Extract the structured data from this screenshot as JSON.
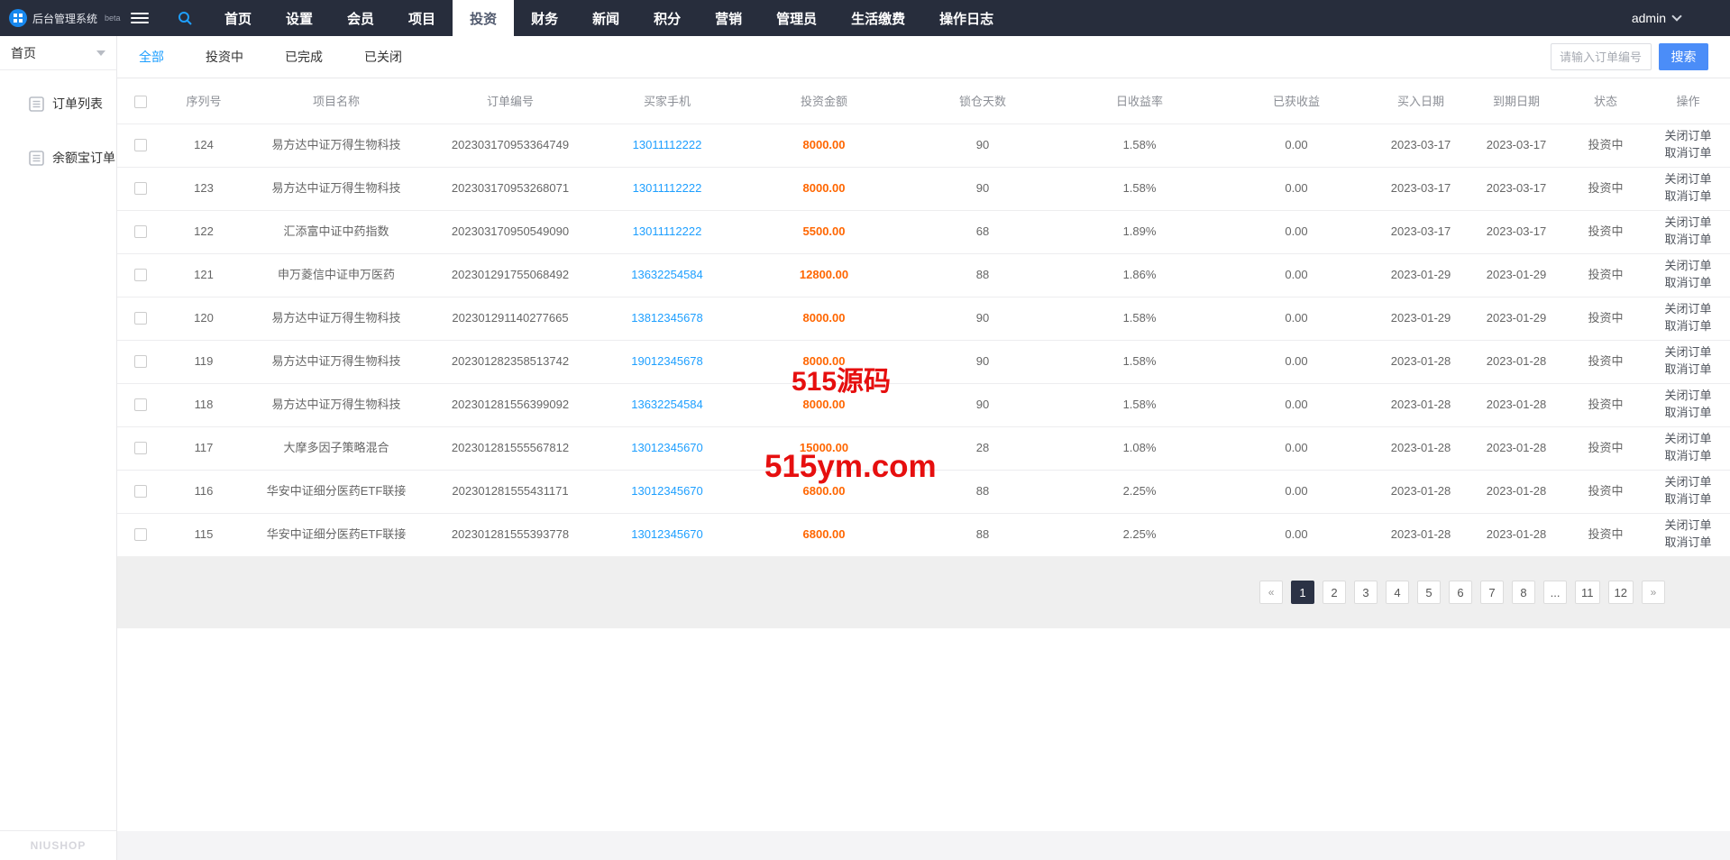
{
  "header": {
    "brand": "后台管理系统",
    "brand_suffix": "beta",
    "nav_items": [
      "首页",
      "设置",
      "会员",
      "项目",
      "投资",
      "财务",
      "新闻",
      "积分",
      "营销",
      "管理员",
      "生活缴费",
      "操作日志"
    ],
    "active_nav": "投资",
    "user": "admin"
  },
  "sidebar": {
    "group_label": "首页",
    "items": [
      {
        "label": "订单列表"
      },
      {
        "label": "余额宝订单"
      }
    ],
    "footer_logo": "NIUSHOP"
  },
  "tabs": {
    "items": [
      "全部",
      "投资中",
      "已完成",
      "已关闭"
    ],
    "active": "全部"
  },
  "search": {
    "placeholder": "请输入订单编号",
    "button_label": "搜索"
  },
  "table": {
    "columns": [
      "序列号",
      "项目名称",
      "订单编号",
      "买家手机",
      "投资金额",
      "锁仓天数",
      "日收益率",
      "已获收益",
      "买入日期",
      "到期日期",
      "状态",
      "操作"
    ],
    "action_labels": [
      "关闭订单",
      "取消订单"
    ],
    "rows": [
      {
        "id": "124",
        "project": "易方达中证万得生物科技",
        "order_no": "202303170953364749",
        "phone": "13011112222",
        "amount": "8000.00",
        "days": "90",
        "rate": "1.58%",
        "income": "0.00",
        "buy_date": "2023-03-17",
        "end_date": "2023-03-17",
        "status": "投资中"
      },
      {
        "id": "123",
        "project": "易方达中证万得生物科技",
        "order_no": "202303170953268071",
        "phone": "13011112222",
        "amount": "8000.00",
        "days": "90",
        "rate": "1.58%",
        "income": "0.00",
        "buy_date": "2023-03-17",
        "end_date": "2023-03-17",
        "status": "投资中"
      },
      {
        "id": "122",
        "project": "汇添富中证中药指数",
        "order_no": "202303170950549090",
        "phone": "13011112222",
        "amount": "5500.00",
        "days": "68",
        "rate": "1.89%",
        "income": "0.00",
        "buy_date": "2023-03-17",
        "end_date": "2023-03-17",
        "status": "投资中"
      },
      {
        "id": "121",
        "project": "申万菱信中证申万医药",
        "order_no": "202301291755068492",
        "phone": "13632254584",
        "amount": "12800.00",
        "days": "88",
        "rate": "1.86%",
        "income": "0.00",
        "buy_date": "2023-01-29",
        "end_date": "2023-01-29",
        "status": "投资中"
      },
      {
        "id": "120",
        "project": "易方达中证万得生物科技",
        "order_no": "202301291140277665",
        "phone": "13812345678",
        "amount": "8000.00",
        "days": "90",
        "rate": "1.58%",
        "income": "0.00",
        "buy_date": "2023-01-29",
        "end_date": "2023-01-29",
        "status": "投资中"
      },
      {
        "id": "119",
        "project": "易方达中证万得生物科技",
        "order_no": "202301282358513742",
        "phone": "19012345678",
        "amount": "8000.00",
        "days": "90",
        "rate": "1.58%",
        "income": "0.00",
        "buy_date": "2023-01-28",
        "end_date": "2023-01-28",
        "status": "投资中"
      },
      {
        "id": "118",
        "project": "易方达中证万得生物科技",
        "order_no": "202301281556399092",
        "phone": "13632254584",
        "amount": "8000.00",
        "days": "90",
        "rate": "1.58%",
        "income": "0.00",
        "buy_date": "2023-01-28",
        "end_date": "2023-01-28",
        "status": "投资中"
      },
      {
        "id": "117",
        "project": "大摩多因子策略混合",
        "order_no": "202301281555567812",
        "phone": "13012345670",
        "amount": "15000.00",
        "days": "28",
        "rate": "1.08%",
        "income": "0.00",
        "buy_date": "2023-01-28",
        "end_date": "2023-01-28",
        "status": "投资中"
      },
      {
        "id": "116",
        "project": "华安中证细分医药ETF联接",
        "order_no": "202301281555431171",
        "phone": "13012345670",
        "amount": "6800.00",
        "days": "88",
        "rate": "2.25%",
        "income": "0.00",
        "buy_date": "2023-01-28",
        "end_date": "2023-01-28",
        "status": "投资中"
      },
      {
        "id": "115",
        "project": "华安中证细分医药ETF联接",
        "order_no": "202301281555393778",
        "phone": "13012345670",
        "amount": "6800.00",
        "days": "88",
        "rate": "2.25%",
        "income": "0.00",
        "buy_date": "2023-01-28",
        "end_date": "2023-01-28",
        "status": "投资中"
      }
    ]
  },
  "pagination": {
    "items": [
      "«",
      "1",
      "2",
      "3",
      "4",
      "5",
      "6",
      "7",
      "8",
      "...",
      "11",
      "12",
      "»"
    ],
    "active": "1"
  },
  "watermark": {
    "line1": "515源码",
    "line2": "515ym.com"
  },
  "colors": {
    "topbar_bg": "#272d3c",
    "accent_blue": "#1e9fff",
    "search_button_blue": "#4b8df8",
    "amount_orange": "#ff6600",
    "watermark_red": "#e60f0f",
    "pagination_active_bg": "#2b3245"
  }
}
